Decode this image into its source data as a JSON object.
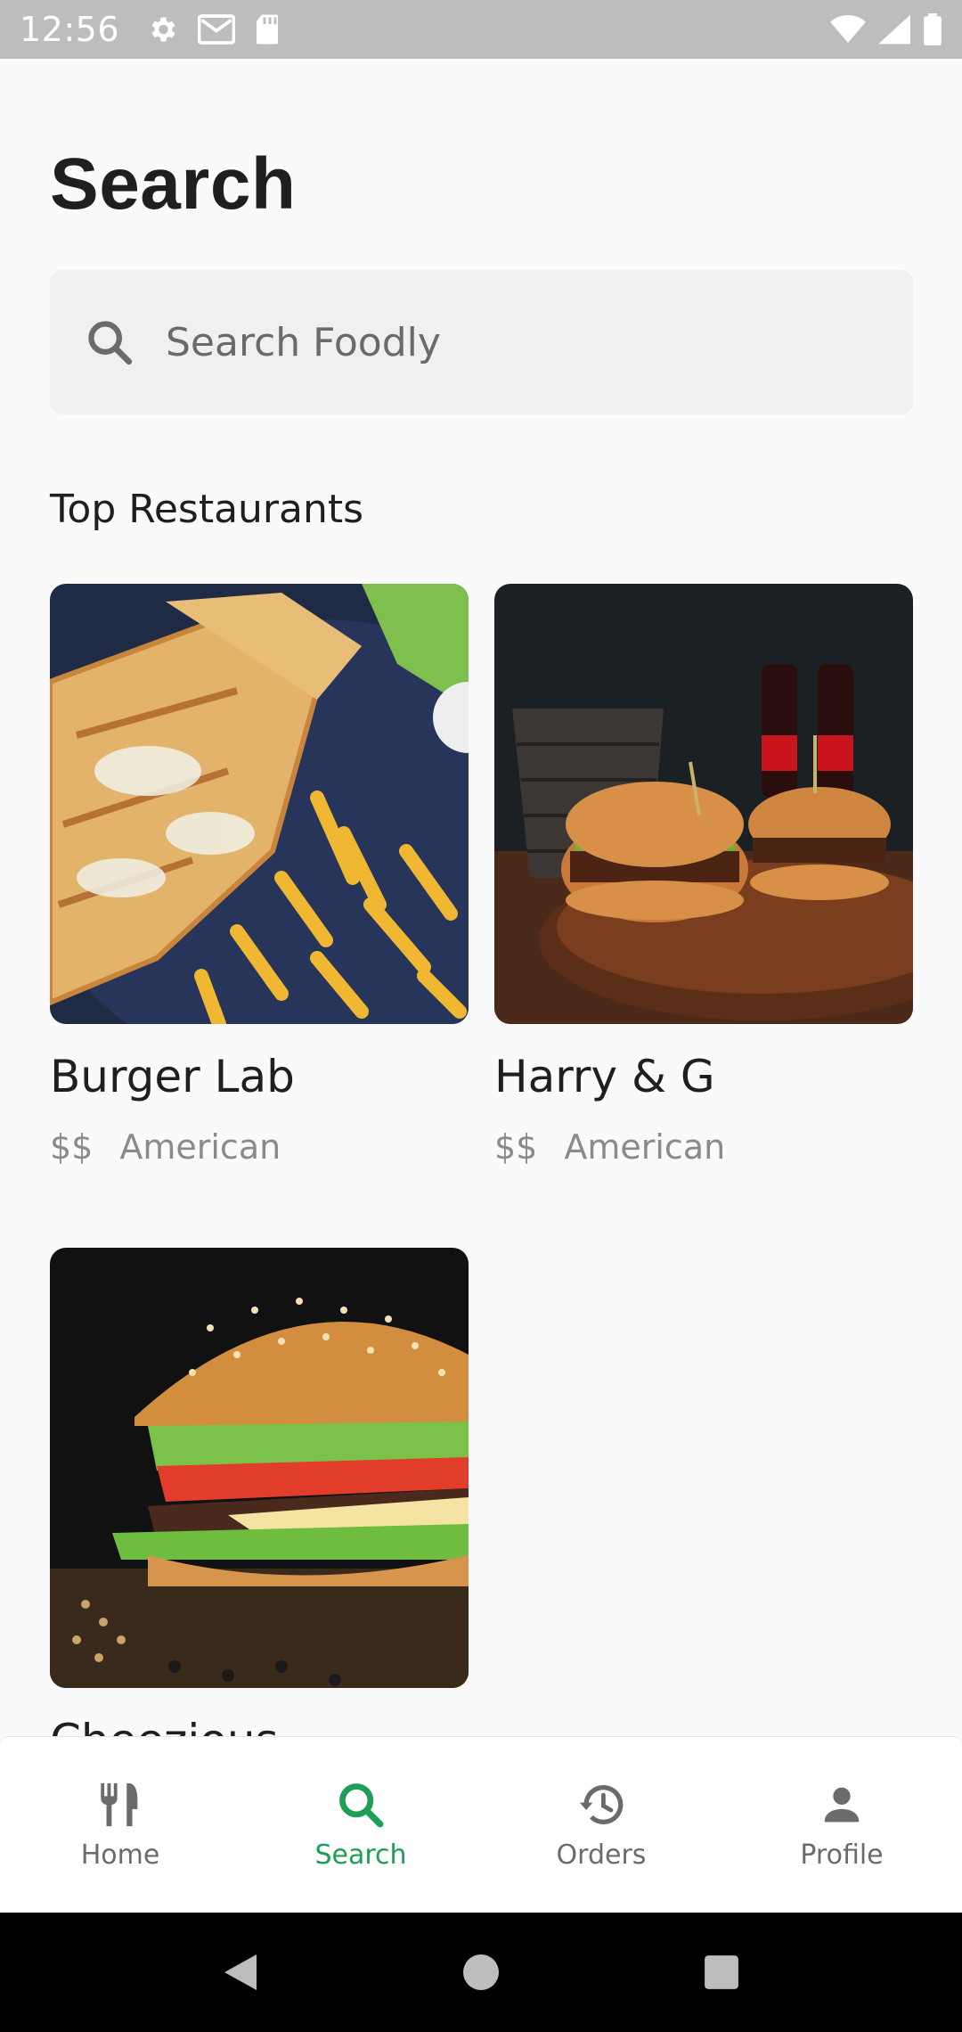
{
  "status_bar": {
    "time": "12:56",
    "left_icons": [
      "gear-icon",
      "gmail-icon",
      "sd-card-icon"
    ],
    "right_icons": [
      "wifi-icon",
      "signal-icon",
      "battery-icon"
    ]
  },
  "page": {
    "title": "Search"
  },
  "search": {
    "placeholder": "Search Foodly",
    "value": ""
  },
  "section": {
    "title": "Top Restaurants"
  },
  "restaurants": [
    {
      "name": "Burger Lab",
      "price": "$$",
      "cuisine": "American",
      "image": "quesadilla-fries-photo"
    },
    {
      "name": "Harry & G",
      "price": "$$",
      "cuisine": "American",
      "image": "burgers-cola-photo"
    },
    {
      "name": "Cheezious",
      "price": "",
      "cuisine": "",
      "image": "cheeseburger-photo"
    }
  ],
  "bottom_nav": {
    "items": [
      {
        "label": "Home",
        "icon": "fork-knife-icon",
        "active": false
      },
      {
        "label": "Search",
        "icon": "search-icon",
        "active": true
      },
      {
        "label": "Orders",
        "icon": "history-icon",
        "active": false
      },
      {
        "label": "Profile",
        "icon": "person-icon",
        "active": false
      }
    ]
  },
  "colors": {
    "accent": "#1e9e57",
    "background": "#fafafa",
    "search_bg": "#f0f0f0"
  }
}
